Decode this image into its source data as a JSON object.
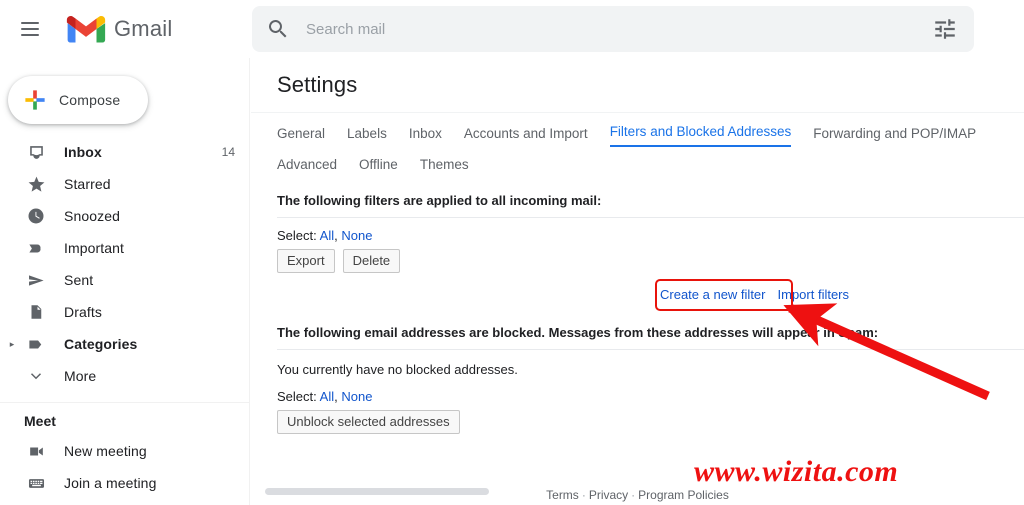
{
  "header": {
    "menu_icon": "hamburger-icon",
    "logo_icon": "gmail-logo-icon",
    "brand": "Gmail",
    "search": {
      "icon": "search-icon",
      "placeholder": "Search mail",
      "value": "",
      "options_icon": "tune-icon"
    }
  },
  "sidebar": {
    "compose": {
      "label": "Compose",
      "icon": "plus-icon"
    },
    "items": [
      {
        "label": "Inbox",
        "icon": "inbox-icon",
        "count": "14",
        "bold": true,
        "expander": ""
      },
      {
        "label": "Starred",
        "icon": "star-icon",
        "count": "",
        "bold": false,
        "expander": ""
      },
      {
        "label": "Snoozed",
        "icon": "clock-icon",
        "count": "",
        "bold": false,
        "expander": ""
      },
      {
        "label": "Important",
        "icon": "label-important-icon",
        "count": "",
        "bold": false,
        "expander": ""
      },
      {
        "label": "Sent",
        "icon": "send-icon",
        "count": "",
        "bold": false,
        "expander": ""
      },
      {
        "label": "Drafts",
        "icon": "draft-icon",
        "count": "",
        "bold": false,
        "expander": ""
      },
      {
        "label": "Categories",
        "icon": "label-icon",
        "count": "",
        "bold": true,
        "expander": "▸"
      },
      {
        "label": "More",
        "icon": "chevron-down-icon",
        "count": "",
        "bold": false,
        "expander": ""
      }
    ],
    "meet": {
      "title": "Meet",
      "items": [
        {
          "label": "New meeting",
          "icon": "video-camera-icon"
        },
        {
          "label": "Join a meeting",
          "icon": "keyboard-icon"
        }
      ]
    }
  },
  "main": {
    "title": "Settings",
    "tabs_row1": [
      {
        "label": "General",
        "active": false
      },
      {
        "label": "Labels",
        "active": false
      },
      {
        "label": "Inbox",
        "active": false
      },
      {
        "label": "Accounts and Import",
        "active": false
      },
      {
        "label": "Filters and Blocked Addresses",
        "active": true
      },
      {
        "label": "Forwarding and POP/IMAP",
        "active": false
      }
    ],
    "tabs_row2": [
      {
        "label": "Advanced",
        "active": false
      },
      {
        "label": "Offline",
        "active": false
      },
      {
        "label": "Themes",
        "active": false
      }
    ],
    "filters_section": {
      "heading": "The following filters are applied to all incoming mail:",
      "select_label": "Select:",
      "select_all": "All",
      "select_comma": ",",
      "select_none": "None",
      "buttons": [
        "Export",
        "Delete"
      ],
      "create_filter_link": "Create a new filter",
      "import_filters_link": "Import filters"
    },
    "blocked_section": {
      "heading": "The following email addresses are blocked. Messages from these addresses will appear in Spam:",
      "empty_note": "You currently have no blocked addresses.",
      "select_label": "Select:",
      "select_all": "All",
      "select_comma": ",",
      "select_none": "None",
      "unblock_button": "Unblock selected addresses"
    },
    "footer": {
      "terms": "Terms",
      "privacy": "Privacy",
      "policies": "Program Policies",
      "separator": "·"
    }
  },
  "annotations": {
    "highlight_color": "#e8130b",
    "arrow_color": "#ee1111",
    "watermark": "www.wizita.com",
    "watermark_color": "#ee1111"
  }
}
